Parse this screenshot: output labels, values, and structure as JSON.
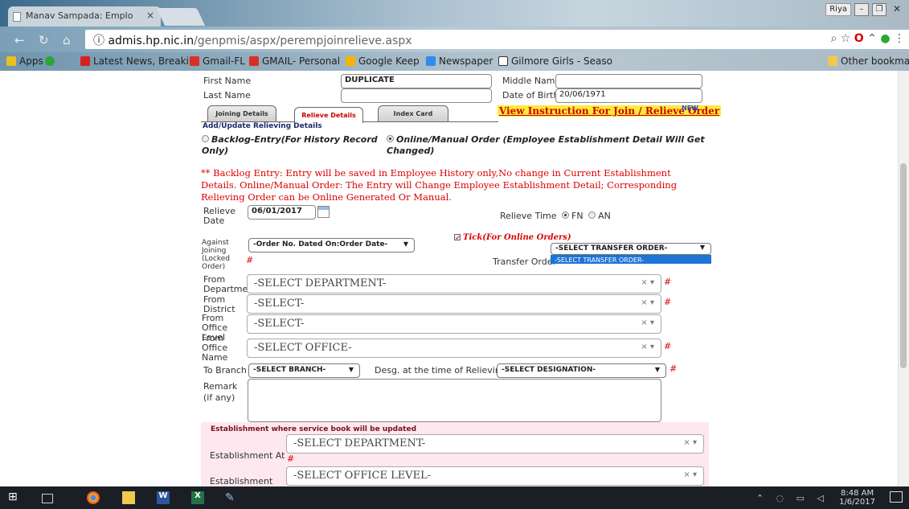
{
  "browser": {
    "tab_title": "Manav Sampada: Emplo",
    "tab_close": "×",
    "url_host": "admis.hp.nic.in",
    "url_path": "/genpmis/aspx/perempjoinrelieve.aspx",
    "user_chip": "Riya",
    "bookmarks": [
      {
        "label": "Apps",
        "color": "#e8c020"
      },
      {
        "label": "",
        "color": "#2aa836"
      },
      {
        "label": "Latest News, Breakin",
        "color": "#d82020"
      },
      {
        "label": "Gmail-FL",
        "color": "#d93025"
      },
      {
        "label": "GMAIL- Personal",
        "color": "#d93025"
      },
      {
        "label": "Google Keep",
        "color": "#f5b400"
      },
      {
        "label": "Newspaper",
        "color": "#2d8cf0"
      },
      {
        "label": "Gilmore Girls - Seaso",
        "color": "#ffffff"
      },
      {
        "label": "Other bookmarks",
        "color": "#f2c94c"
      }
    ]
  },
  "form": {
    "first_name_label": "First Name",
    "first_name_value": "DUPLICATE",
    "middle_name_label": "Middle Name",
    "last_name_label": "Last Name",
    "dob_label": "Date of Birth",
    "dob_value": "20/06/1971",
    "tabs": [
      "Joining Details",
      "Relieve Details",
      "Index Card"
    ],
    "instruction_link": "View Instruction For Join / Relieve Order",
    "new_badge": "NEW",
    "section_title": "Add/Update Relieving Details",
    "radio_backlog": "Backlog-Entry(For History Record Only)",
    "radio_backlog_l1": "Backlog-Entry(For History Record",
    "radio_backlog_l2": "Only)",
    "radio_online_l1": "Online/Manual Order (Employee Establishment Detail Will Get",
    "radio_online_l2": "Changed)",
    "note": "** Backlog Entry: Entry will be saved in Employee History only,No change in Current Establishment Details. Online/Manual Order: The Entry will Change Employee Establishment Detail; Corresponding Relieving Order can be Online Generated Or Manual.",
    "relieve_date_label": "Relieve Date",
    "relieve_date_value": "06/01/2017",
    "relieve_time_label": "Relieve Time",
    "time_fn": "FN",
    "time_an": "AN",
    "tick_label": "Tick(For Online Orders)",
    "against_joining_label": "Against Joining (Locked Order)",
    "against_joining_value": "-Order No. Dated On:Order Date-",
    "transfer_order_label": "Transfer Order",
    "transfer_order_value": "-SELECT TRANSFER ORDER-",
    "transfer_order_option": "-SELECT TRANSFER ORDER-",
    "from_department_label": "From Department",
    "from_department_value": "-SELECT DEPARTMENT-",
    "from_district_label": "From District",
    "from_district_value": "-SELECT-",
    "from_office_level_label": "From Office Level",
    "from_office_level_value": "-SELECT-",
    "from_office_name_label": "From Office Name",
    "from_office_name_value": "-SELECT OFFICE-",
    "to_branch_label": "To Branch",
    "to_branch_value": "-SELECT BRANCH-",
    "desg_label": "Desg. at the time of Relieving",
    "desg_value": "-SELECT DESIGNATION-",
    "remark_label": "Remark (if any)",
    "required_mark": "#",
    "clear_caret": "× ▾",
    "establishment": {
      "title": "Establishment where service book will be updated",
      "at_label": "Establishment At",
      "at_value": "-SELECT DEPARTMENT-",
      "office_label": "Establishment Office Level",
      "office_value": "-SELECT OFFICE LEVEL-"
    }
  },
  "taskbar": {
    "time": "8:48 AM",
    "date": "1/6/2017"
  }
}
